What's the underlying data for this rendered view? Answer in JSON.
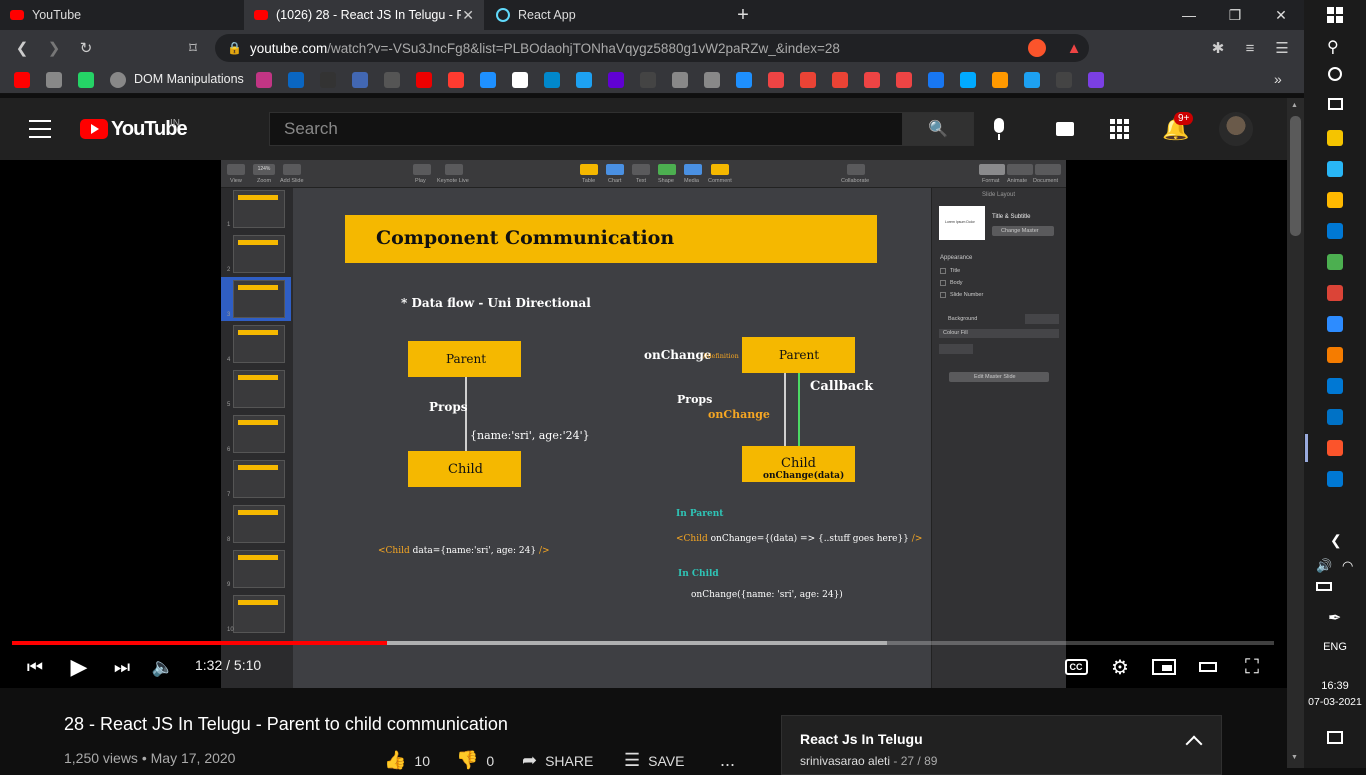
{
  "tabs": [
    {
      "title": "YouTube",
      "active": false
    },
    {
      "title": "(1026) 28 - React JS In Telugu - Pa",
      "active": true
    },
    {
      "title": "React App",
      "active": false
    }
  ],
  "new_tab_glyph": "+",
  "window_controls": {
    "minimize": "—",
    "restore": "❐",
    "close": "✕"
  },
  "address": {
    "host": "youtube.com",
    "path": "/watch?v=-VSu3JncFg8&list=PLBOdaohjTONhaVqygz5880g1vW2paRZw_&index=28"
  },
  "bookmarks": {
    "folder_label": "DOM Manipulations",
    "overflow": "»",
    "colors": [
      "#ff0000",
      "#888",
      "#25d366",
      "#c13584",
      "#0a66c2",
      "#333",
      "#4267b2",
      "#555",
      "#e00",
      "#ff3b30",
      "#1e90ff",
      "#fff",
      "#0088cc",
      "#1da1f2",
      "#6001d2",
      "#444",
      "#888",
      "#888",
      "#1e90ff",
      "#e44",
      "#ea4335",
      "#ea4335",
      "#e44",
      "#e44",
      "#1877f2",
      "#0af",
      "#f90",
      "#1da1f2",
      "#444",
      "#7b3fe4"
    ]
  },
  "youtube": {
    "logo": "YouTube",
    "region": "IN",
    "search_placeholder": "Search",
    "notification_count": "9+"
  },
  "keynote": {
    "toolbar_left": [
      "View",
      "Zoom",
      "Add Slide"
    ],
    "zoom_value": "124%",
    "toolbar_center": [
      "Play",
      "Keynote Live"
    ],
    "toolbar_tools": [
      "Table",
      "Chart",
      "Text",
      "Shape",
      "Media",
      "Comment"
    ],
    "toolbar_collab": "Collaborate",
    "toolbar_right": [
      "Format",
      "Animate",
      "Document"
    ],
    "slide_numbers": [
      "1",
      "2",
      "3",
      "4",
      "5",
      "6",
      "7",
      "8",
      "9",
      "10"
    ],
    "selected_slide": 3,
    "inspector": {
      "header": "Slide Layout",
      "layout_name": "Title & Subtitle",
      "change_master": "Change Master",
      "thumb_text": "Lorem Ipsum Dolor",
      "appearance": "Appearance",
      "checks": [
        "Title",
        "Body",
        "Slide Number"
      ],
      "background": "Background",
      "fill": "Colour Fill",
      "edit_master": "Edit Master Slide"
    }
  },
  "slide": {
    "title": "Component Communication",
    "subtitle": "* Data flow - Uni Directional",
    "left": {
      "parent": "Parent",
      "child": "Child",
      "props": "Props",
      "data": "{name:'sri', age:'24'}",
      "code_open": "<Child",
      "code_mid": "data={name:'sri', age: 24}",
      "code_close": "/>"
    },
    "right": {
      "onchange_label": "onChange",
      "definition": "//definition",
      "parent": "Parent",
      "callback": "Callback",
      "props": "Props",
      "onchange_prop": "onChange",
      "child": "Child",
      "child_sub": "onChange(data)",
      "in_parent": "In Parent",
      "code_open": "<Child",
      "code_mid": "onChange={(data) => {..stuff goes here}}",
      "code_close": "/>",
      "in_child": "In Child",
      "child_call": "onChange({name: 'sri', age: 24})"
    }
  },
  "player": {
    "time": "1:32 / 5:10",
    "played": 0.297,
    "buffered": 0.693
  },
  "video": {
    "title": "28 - React JS In Telugu - Parent to child communication",
    "views": "1,250 views",
    "date": "May 17, 2020",
    "likes": "10",
    "dislikes": "0",
    "share": "SHARE",
    "save": "SAVE",
    "more": "..."
  },
  "playlist": {
    "title": "React Js In Telugu",
    "owner": "srinivasarao aleti",
    "position": "- 27 / 89"
  },
  "taskbar": {
    "lang": "ENG",
    "time": "16:39",
    "date": "07-03-2021",
    "icon_colors": [
      "#f5c400",
      "#29b6f6",
      "#ffb900",
      "#0078d4",
      "#4caf50",
      "#db4437",
      "#2d8cff",
      "#f57c00",
      "#0078d4",
      "#0072c6",
      "#fb542b",
      "#0078d4"
    ]
  },
  "colors": {
    "accent_red": "#ff0000",
    "slide_yellow": "#f5b800",
    "slide_orange": "#f5a623",
    "slide_teal": "#2ec4b6"
  }
}
